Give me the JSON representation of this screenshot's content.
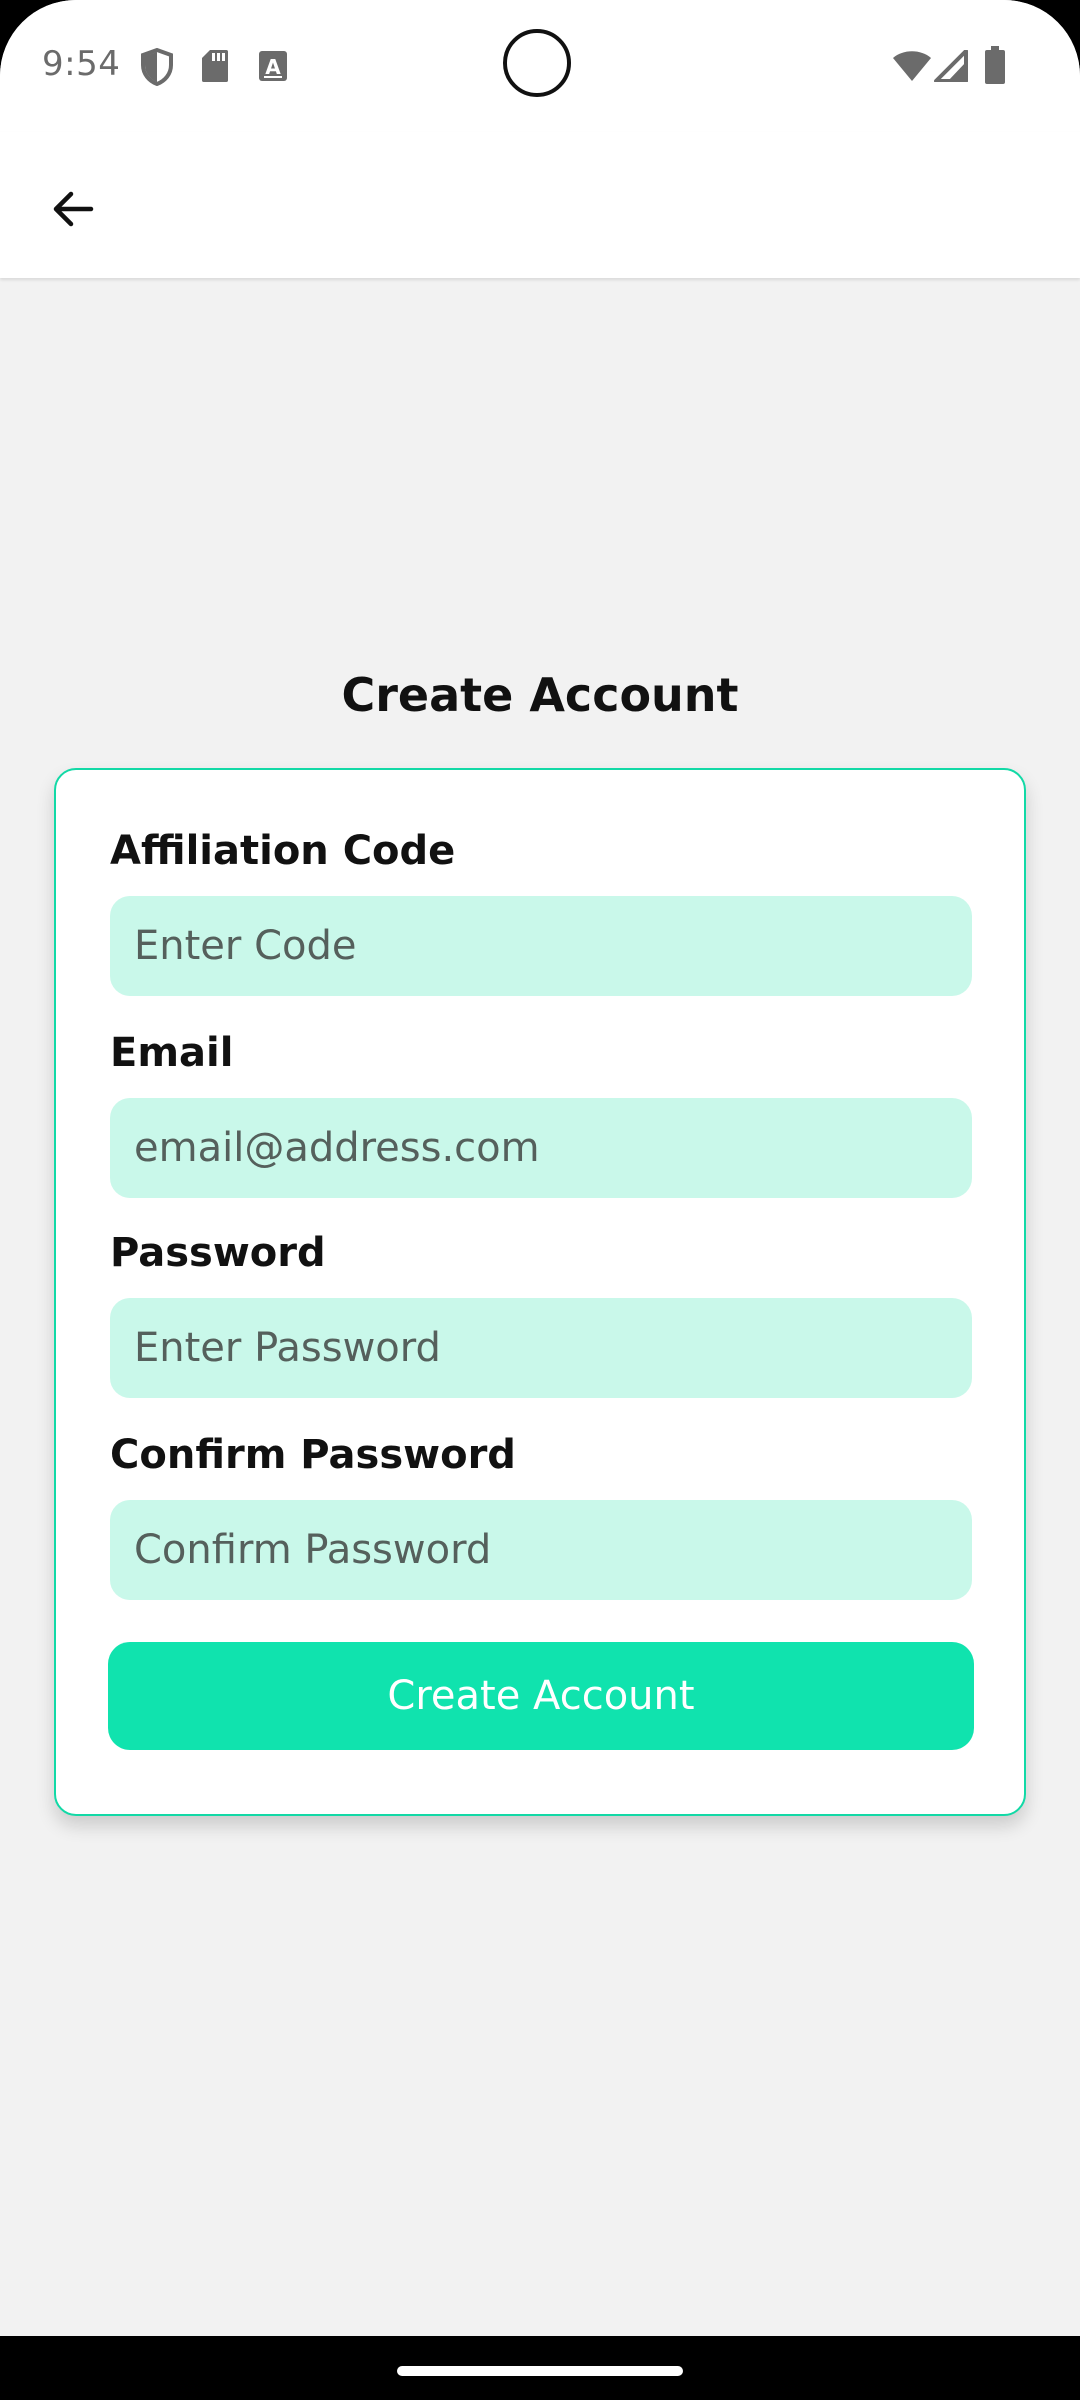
{
  "status_bar": {
    "time": "9:54",
    "left_icons": [
      "shield-icon",
      "sd-card-icon",
      "font-a-icon"
    ],
    "right_icons": [
      "wifi-icon",
      "signal-icon",
      "battery-icon"
    ]
  },
  "app_bar": {
    "back_icon": "arrow-left-icon"
  },
  "page": {
    "title": "Create Account"
  },
  "form": {
    "affiliation": {
      "label": "Affiliation Code",
      "placeholder": "Enter Code",
      "value": ""
    },
    "email": {
      "label": "Email",
      "placeholder": "email@address.com",
      "value": ""
    },
    "password": {
      "label": "Password",
      "placeholder": "Enter Password",
      "value": ""
    },
    "confirm_password": {
      "label": "Confirm Password",
      "placeholder": "Confirm Password",
      "value": ""
    },
    "submit_label": "Create Account"
  },
  "colors": {
    "accent": "#10e3ae",
    "card_border": "#12d9a6",
    "input_background": "#c9f8ea",
    "page_background": "#f2f2f2"
  }
}
